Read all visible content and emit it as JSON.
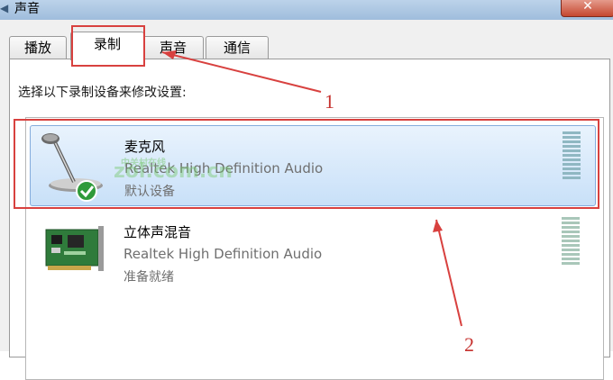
{
  "window": {
    "title": "声音",
    "close_label": "✕"
  },
  "tabs": [
    {
      "label": "播放",
      "active": false
    },
    {
      "label": "录制",
      "active": true
    },
    {
      "label": "声音",
      "active": false
    },
    {
      "label": "通信",
      "active": false
    }
  ],
  "instruction": "选择以下录制设备来修改设置:",
  "devices": [
    {
      "name": "麦克风",
      "driver": "Realtek High Definition Audio",
      "status": "默认设备",
      "icon": "microphone-icon",
      "selected": true
    },
    {
      "name": "立体声混音",
      "driver": "Realtek High Definition Audio",
      "status": "准备就绪",
      "icon": "sound-card-icon",
      "selected": false
    }
  ],
  "watermark": {
    "text": "zol.com.cn",
    "sub": "中关村在线"
  },
  "annotations": [
    {
      "label": "1",
      "color": "#d8413f"
    },
    {
      "label": "2",
      "color": "#d8413f"
    }
  ]
}
